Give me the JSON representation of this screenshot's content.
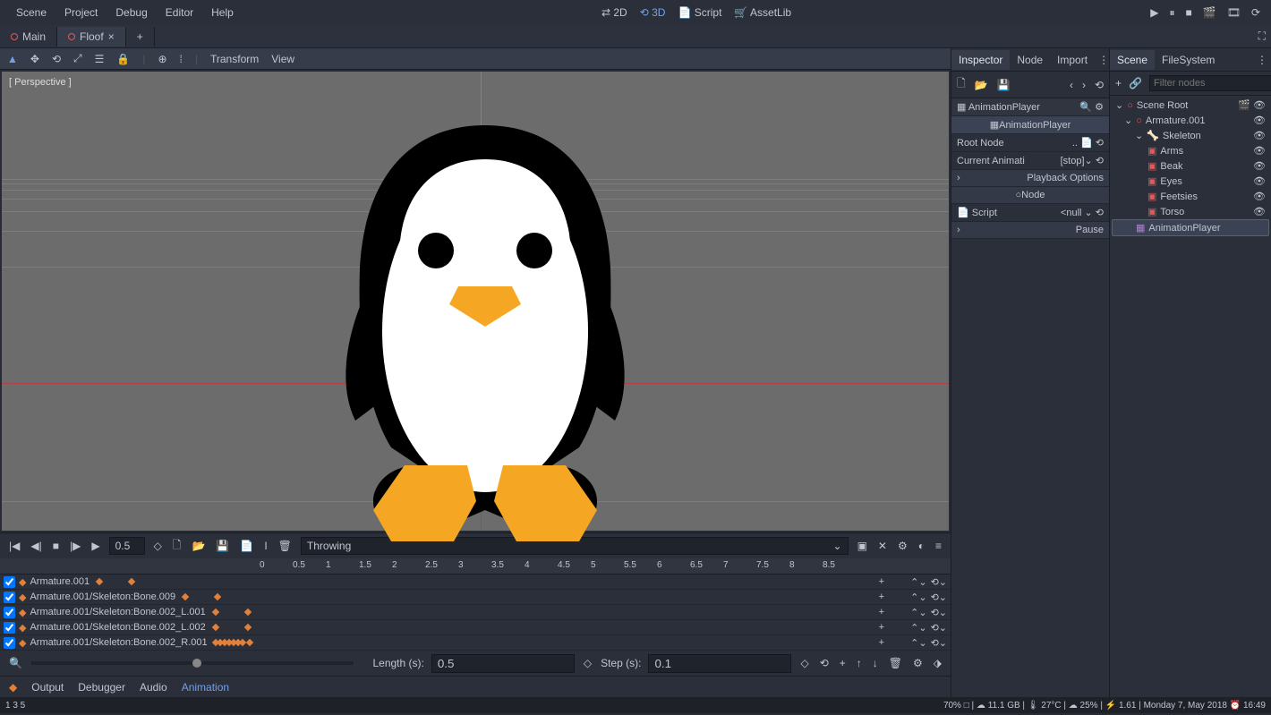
{
  "menubar": {
    "items": [
      "Scene",
      "Project",
      "Debug",
      "Editor",
      "Help"
    ]
  },
  "modes": {
    "items": [
      "2D",
      "3D",
      "Script",
      "AssetLib"
    ],
    "active": "3D"
  },
  "tabs": {
    "items": [
      "Main",
      "Floof"
    ],
    "active": "Floof",
    "add": "+"
  },
  "toolbar3d": {
    "transform": "Transform",
    "view": "View"
  },
  "viewport": {
    "label": "[ Perspective ]"
  },
  "anim": {
    "time": "0.5",
    "name": "Throwing",
    "length_label": "Length (s):",
    "length": "0.5",
    "step_label": "Step (s):",
    "step": "0.1",
    "ticks": [
      "0",
      "0.5",
      "1",
      "1.5",
      "2",
      "2.5",
      "3",
      "3.5",
      "4",
      "4.5",
      "5",
      "5.5",
      "6",
      "6.5",
      "7",
      "7.5",
      "8",
      "8.5"
    ],
    "tracks": [
      "Armature.001",
      "Armature.001/Skeleton:Bone.009",
      "Armature.001/Skeleton:Bone.002_L.001",
      "Armature.001/Skeleton:Bone.002_L.002",
      "Armature.001/Skeleton:Bone.002_R.001"
    ]
  },
  "bottom_tabs": {
    "items": [
      "Output",
      "Debugger",
      "Audio",
      "Animation"
    ],
    "active": "Animation"
  },
  "inspector": {
    "tabs": [
      "Inspector",
      "Node",
      "Import"
    ],
    "active": "Inspector",
    "object": "AnimationPlayer",
    "selected": "AnimationPlayer",
    "root_node": "Root Node",
    "root_val": "..",
    "current_anim": "Current Animati",
    "current_val": "[stop]",
    "playback": "Playback Options",
    "node_section": "Node",
    "script": "Script",
    "script_val": "<null",
    "pause": "Pause"
  },
  "scene": {
    "tabs": [
      "Scene",
      "FileSystem"
    ],
    "active": "Scene",
    "filter_placeholder": "Filter nodes",
    "tree": {
      "root": "Scene Root",
      "armature": "Armature.001",
      "skeleton": "Skeleton",
      "bones": [
        "Arms",
        "Beak",
        "Eyes",
        "Feetsies",
        "Torso"
      ],
      "anim": "AnimationPlayer"
    }
  },
  "status": {
    "left": "1  3   5",
    "right": "70%  □  |  ☁ 11.1 GB  |  🌡 27°C  |  ☁ 25%  |  ⚡ 1.61  | Monday   7, May 2018   ⏰ 16:49"
  }
}
